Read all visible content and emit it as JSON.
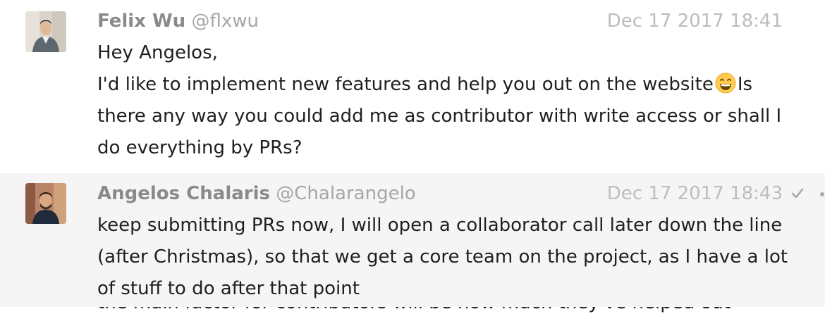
{
  "messages": [
    {
      "display_name": "Felix Wu",
      "username": "@flxwu",
      "timestamp": "Dec 17 2017 18:41",
      "lines": [
        "Hey Angelos,",
        "I'd like to implement new features and help you out on the website",
        "Is there any way you could add me as contributor with write access or shall I do everything by PRs?"
      ],
      "emoji": "grinning-face-emoji"
    },
    {
      "display_name": "Angelos Chalaris",
      "username": "@Chalarangelo",
      "timestamp": "Dec 17 2017 18:43",
      "lines": [
        "keep submitting PRs now, I will open a collaborator call later down the line (after Christmas), so that we get a core team on the project, as I have a lot of stuff to do after that point"
      ],
      "status_icon": "checkmark-icon"
    },
    {
      "partial_text": "the main factor for contributors will be how much they've helped out"
    }
  ],
  "colors": {
    "name": "#8a8a8a",
    "username": "#a6a6a6",
    "timestamp": "#bdbdbd",
    "text": "#1f1f1f",
    "highlight_row": "#f5f5f5"
  }
}
